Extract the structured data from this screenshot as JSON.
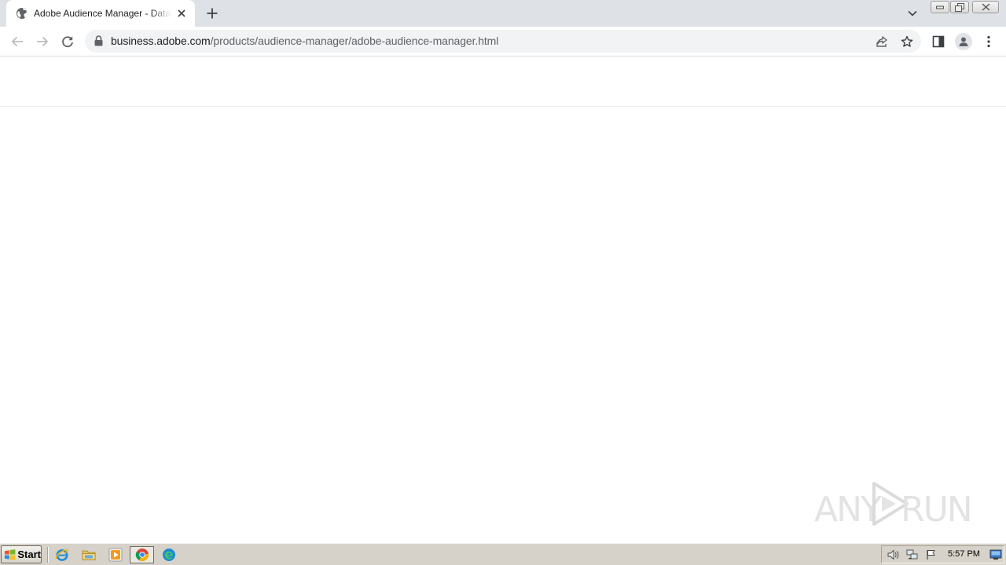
{
  "browser": {
    "tab": {
      "title": "Adobe Audience Manager - Data Management Platform",
      "favicon": "globe-icon"
    },
    "address_bar": {
      "url_host": "business.adobe.com",
      "url_path": "/products/audience-manager/adobe-audience-manager.html",
      "secure_icon": "lock-icon"
    },
    "toolbar_icons": [
      "back-icon",
      "forward-icon",
      "reload-icon",
      "share-icon",
      "star-icon",
      "side-panel-icon",
      "profile-icon",
      "menu-icon"
    ],
    "colors": {
      "tabstrip": "#dee1e6",
      "omnibox": "#f1f3f4",
      "url_host": "#202124",
      "url_path": "#5f6368"
    }
  },
  "watermark": {
    "left_text": "ANY",
    "right_text": "RUN"
  },
  "taskbar": {
    "start_label": "Start",
    "quick_launch": [
      "internet-explorer-icon",
      "file-explorer-icon",
      "media-player-icon",
      "chrome-icon",
      "edge-icon"
    ],
    "tray_icons": [
      "volume-icon",
      "network-icon",
      "flag-icon",
      "show-desktop-icon"
    ],
    "clock": "5:57 PM",
    "colors": {
      "taskbar": "#d6d2c9"
    }
  }
}
